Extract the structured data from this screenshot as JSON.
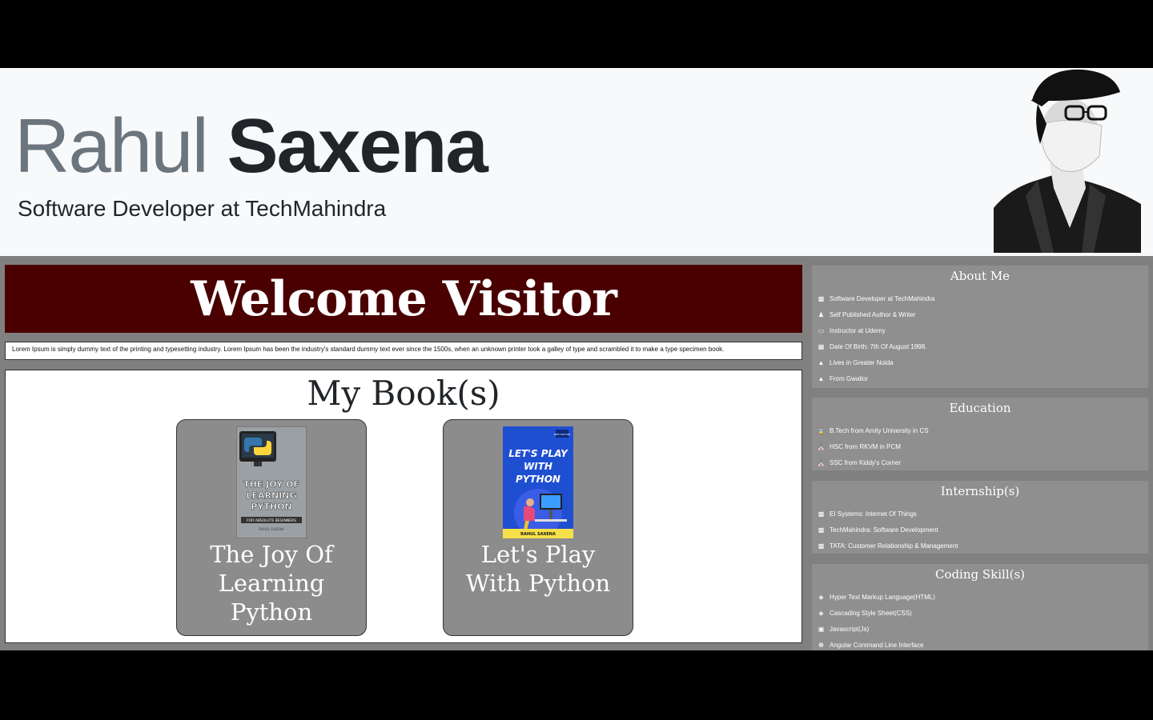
{
  "header": {
    "first_name": "Rahul",
    "last_name": "Saxena",
    "subtitle": "Software Developer at TechMahindra"
  },
  "welcome": {
    "title": "Welcome Visitor"
  },
  "intro": {
    "text": "Lorem Ipsum is simply dummy text of the printing and typesetting industry. Lorem Ipsum has been the industry's standard dummy text ever since the 1500s, when an unknown printer took a galley of type and scrambled it to make a type specimen book."
  },
  "books": {
    "heading": "My Book(s)",
    "items": [
      {
        "title": "The Joy Of Learning Python",
        "cover_lines": [
          "THE JOY OF",
          "LEARNING",
          "PYTHON"
        ],
        "cover_sub": "FOR ABSOLUTE BEGINNERS",
        "cover_author": "RAHUL SAXENA"
      },
      {
        "title": "Let's Play With Python",
        "cover_lines": [
          "LET'S PLAY",
          "WITH",
          "PYTHON"
        ],
        "cover_badge": "NEW EDITION",
        "cover_author": "RAHUL SAXENA"
      }
    ]
  },
  "sidebar": {
    "about": {
      "heading": "About Me",
      "items": [
        {
          "icon": "briefcase-icon",
          "label": "Software Developer at TechMahindra"
        },
        {
          "icon": "user-pen-icon",
          "label": "Self Published Author & Writer"
        },
        {
          "icon": "chalkboard-teacher-icon",
          "label": "Instructor at Udemy"
        },
        {
          "icon": "calendar-icon",
          "label": "Date Of Birth: 7th Of August 1998."
        },
        {
          "icon": "map-location-icon",
          "label": "Lives in Greater Noida"
        },
        {
          "icon": "map-location-icon",
          "label": "From Gwalior"
        }
      ]
    },
    "education": {
      "heading": "Education",
      "items": [
        {
          "icon": "hourglass-icon",
          "label": "B.Tech from Amity University in CS"
        },
        {
          "icon": "school-icon",
          "label": "HSC from RKVM in PCM"
        },
        {
          "icon": "school-icon",
          "label": "SSC from Kiddy's Corner"
        }
      ]
    },
    "internships": {
      "heading": "Internship(s)",
      "items": [
        {
          "icon": "briefcase-icon",
          "label": "EI Systems: Internet Of Things"
        },
        {
          "icon": "briefcase-icon",
          "label": "TechMahindra: Software Development"
        },
        {
          "icon": "briefcase-icon",
          "label": "TATA: Customer Relationship & Management"
        }
      ]
    },
    "skills": {
      "heading": "Coding Skill(s)",
      "items": [
        {
          "icon": "html5-icon",
          "label": "Hyper Text Markup Language(HTML)"
        },
        {
          "icon": "css3-icon",
          "label": "Cascading Style Sheet(CSS)"
        },
        {
          "icon": "js-icon",
          "label": "Javascript(Js)"
        },
        {
          "icon": "angular-icon",
          "label": "Angular Command Line Interface"
        }
      ]
    }
  },
  "colors": {
    "welcome_bg": "#4a0000",
    "content_bg": "#808080",
    "card_bg": "#8c8c8c",
    "sidebar_bg": "#8f8f8f",
    "header_bg": "#f8f9fa"
  }
}
